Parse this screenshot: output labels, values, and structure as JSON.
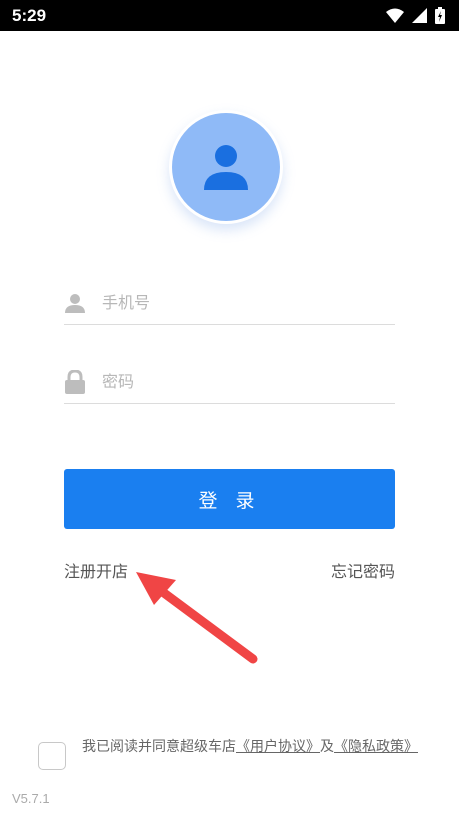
{
  "status_bar": {
    "time": "5:29"
  },
  "avatar": {
    "icon": "user-icon",
    "bg_color": "#8fbaf7"
  },
  "form": {
    "phone_placeholder": "手机号",
    "password_placeholder": "密码",
    "login_label": "登 录",
    "register_label": "注册开店",
    "forgot_label": "忘记密码"
  },
  "agreement": {
    "prefix": "我已阅读并同意超级车店",
    "user_agreement": "《用户协议》",
    "connector": "及",
    "privacy_policy": "《隐私政策》"
  },
  "version": "V5.7.1",
  "colors": {
    "primary": "#1a7ff0",
    "annotation_arrow": "#f04545"
  }
}
